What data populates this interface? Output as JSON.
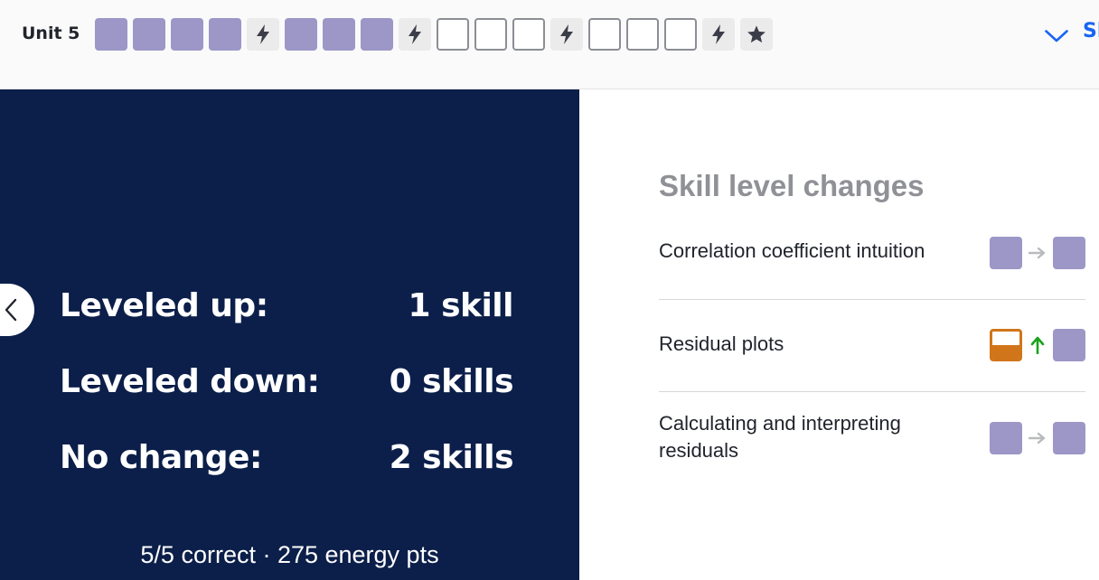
{
  "topbar": {
    "unit_label": "Unit 5",
    "show_label": "Sh",
    "progress": [
      {
        "type": "mastered",
        "icon": ""
      },
      {
        "type": "mastered",
        "icon": ""
      },
      {
        "type": "mastered",
        "icon": ""
      },
      {
        "type": "mastered",
        "icon": ""
      },
      {
        "type": "quiz",
        "icon": "lightning-icon"
      },
      {
        "type": "mastered",
        "icon": ""
      },
      {
        "type": "mastered",
        "icon": ""
      },
      {
        "type": "mastered",
        "icon": ""
      },
      {
        "type": "quiz",
        "icon": "lightning-icon"
      },
      {
        "type": "empty",
        "icon": ""
      },
      {
        "type": "empty",
        "icon": ""
      },
      {
        "type": "empty",
        "icon": ""
      },
      {
        "type": "quiz",
        "icon": "lightning-icon"
      },
      {
        "type": "empty",
        "icon": ""
      },
      {
        "type": "empty",
        "icon": ""
      },
      {
        "type": "empty",
        "icon": ""
      },
      {
        "type": "quiz",
        "icon": "lightning-icon"
      },
      {
        "type": "test",
        "icon": "star-icon"
      }
    ]
  },
  "summary": {
    "leveled_up_label": "Leveled up:",
    "leveled_up_value": "1 skill",
    "leveled_down_label": "Leveled down:",
    "leveled_down_value": "0 skills",
    "no_change_label": "No change:",
    "no_change_value": "2 skills",
    "footer": "5/5 correct · 275 energy pts"
  },
  "changes": {
    "title": "Skill level changes",
    "skills": [
      {
        "name": "Correlation coefficient intuition",
        "from": "mastered",
        "change": "arrow-right-icon",
        "to": "mastered"
      },
      {
        "name": "Residual plots",
        "from": "familiar",
        "change": "arrow-up-icon",
        "to": "mastered"
      },
      {
        "name": "Calculating and interpreting residuals",
        "from": "mastered",
        "change": "arrow-right-icon",
        "to": "mastered"
      }
    ]
  },
  "colors": {
    "mastered": "#9c97c7",
    "familiar": "#d1751a",
    "navy": "#0c1f4a",
    "link_blue": "#1865f2",
    "up_green": "#1aa31a",
    "arrow_gray": "#b8babd"
  }
}
